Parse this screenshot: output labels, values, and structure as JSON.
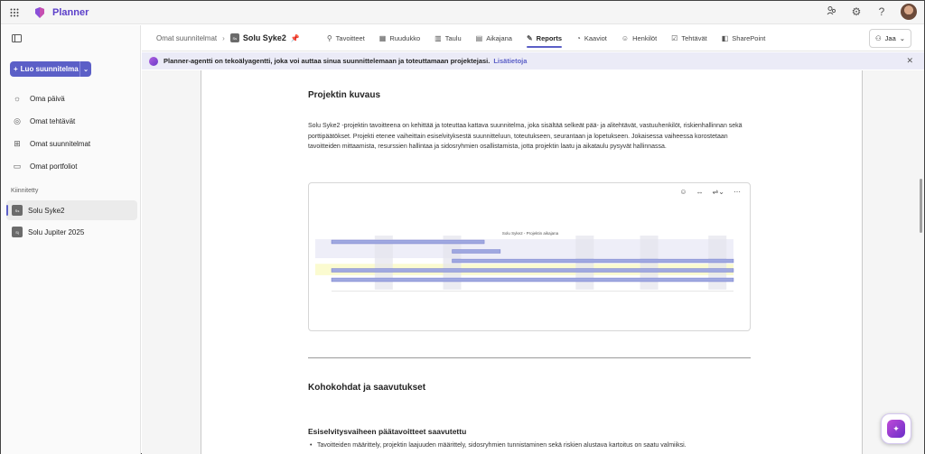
{
  "app": {
    "name": "Planner"
  },
  "topbar": {
    "icons": [
      "waffle-icon",
      "people-icon",
      "settings-icon",
      "help-icon"
    ],
    "help": "?"
  },
  "sidebar": {
    "create_label": "Luo suunnitelma",
    "items": [
      {
        "label": "Oma päivä",
        "icon": "sun-icon"
      },
      {
        "label": "Omat tehtävät",
        "icon": "task-icon"
      },
      {
        "label": "Omat suunnitelmat",
        "icon": "grid-icon"
      },
      {
        "label": "Omat portfoliot",
        "icon": "folder-icon"
      }
    ],
    "pinned_label": "Kiinnitetty",
    "pinned": [
      {
        "badge": "Ss",
        "label": "Solu Syke2",
        "active": true
      },
      {
        "badge": "Sj",
        "label": "Solu Jupiter 2025",
        "active": false
      }
    ]
  },
  "header": {
    "breadcrumb": "Omat suunnitelmat",
    "plan_badge": "Ss",
    "plan_title": "Solu Syke2",
    "tabs": [
      {
        "label": "Tavoitteet",
        "icon": "⚲"
      },
      {
        "label": "Ruudukko",
        "icon": "▦"
      },
      {
        "label": "Taulu",
        "icon": "▥"
      },
      {
        "label": "Aikajana",
        "icon": "▤"
      },
      {
        "label": "Reports",
        "icon": "✎",
        "active": true
      },
      {
        "label": "Kaaviot",
        "icon": "◔"
      },
      {
        "label": "Henkilöt",
        "icon": "☺"
      },
      {
        "label": "Tehtävät",
        "icon": "☑"
      },
      {
        "label": "SharePoint",
        "icon": "◧"
      }
    ],
    "share_label": "Jaa"
  },
  "banner": {
    "text": "Planner-agentti on tekoälyagentti, joka voi auttaa sinua suunnittelemaan ja toteuttamaan projektejasi.",
    "link": "Lisätietoja"
  },
  "document": {
    "section1_title": "Projektin kuvaus",
    "section1_text": "Solu Syke2 -projektin tavoitteena on kehittää ja toteuttaa kattava suunnitelma, joka sisältää selkeät pää- ja alitehtävät, vastuuhenkilöt, riskienhallinnan sekä porttipäätökset. Projekti etenee vaiheittain esiselvityksestä suunnitteluun, toteutukseen, seurantaan ja lopetukseen. Jokaisessa vaiheessa korostetaan tavoitteiden mittaamista, resurssien hallintaa ja sidosryhmien osallistamista, jotta projektin laatu ja aikataulu pysyvät hallinnassa.",
    "chart_title": "Solu Syke2 - Projektin aikajana",
    "section2_title": "Kohokohdat ja saavutukset",
    "section3_title": "Esiselvitysvaiheen päätavoitteet saavutettu",
    "bullet1": "Tavoitteiden määrittely, projektin laajuuden määrittely, sidosryhmien tunnistaminen sekä riskien alustava kartoitus on saatu valmiiksi."
  },
  "chart_data": {
    "type": "bar",
    "title": "Solu Syke2 - Projektin aikajana",
    "note": "Gantt timeline; tiny tick and bar labels are illegible in screenshot",
    "bars": [
      {
        "row": 0,
        "start": 0.0,
        "end": 0.38
      },
      {
        "row": 1,
        "start": 0.3,
        "end": 0.42
      },
      {
        "row": 2,
        "start": 0.3,
        "end": 1.0
      },
      {
        "row": 3,
        "start": 0.0,
        "end": 1.0
      },
      {
        "row": 4,
        "start": 0.0,
        "end": 1.0
      }
    ],
    "colors": {
      "bar": "#9fa8e0",
      "band": "#fbfbd0",
      "stripe": "#e4e4ec"
    }
  }
}
